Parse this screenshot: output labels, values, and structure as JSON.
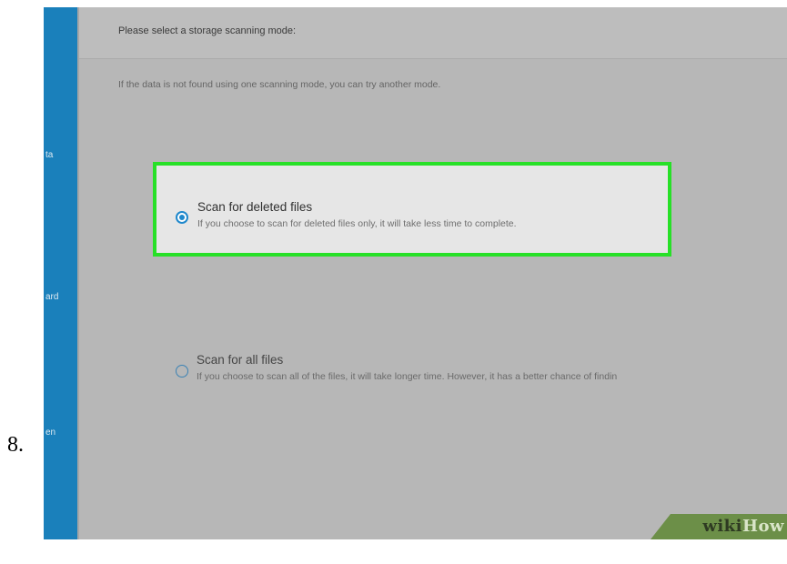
{
  "step": {
    "number": "8."
  },
  "sidebar": {
    "items": [
      {
        "label": "ta"
      },
      {
        "label": "ard"
      },
      {
        "label": "en"
      }
    ]
  },
  "header": {
    "title": "Please select a storage scanning mode:"
  },
  "hint": {
    "text": "If the data is not found using one scanning mode, you can try another mode."
  },
  "options": [
    {
      "title": "Scan for deleted files",
      "description": "If you choose to scan for deleted files only, it will take less time to complete.",
      "selected": true
    },
    {
      "title": "Scan for all files",
      "description": "If you choose to scan all of the files, it will take longer time. However, it has a better chance of findin",
      "selected": false
    }
  ],
  "watermark": {
    "part1": "wiki",
    "part2": "How"
  },
  "colors": {
    "sidebar": "#1a80bb",
    "highlight": "#27e027",
    "radio_accent": "#1f88cc",
    "background": "#b7b7b7"
  }
}
